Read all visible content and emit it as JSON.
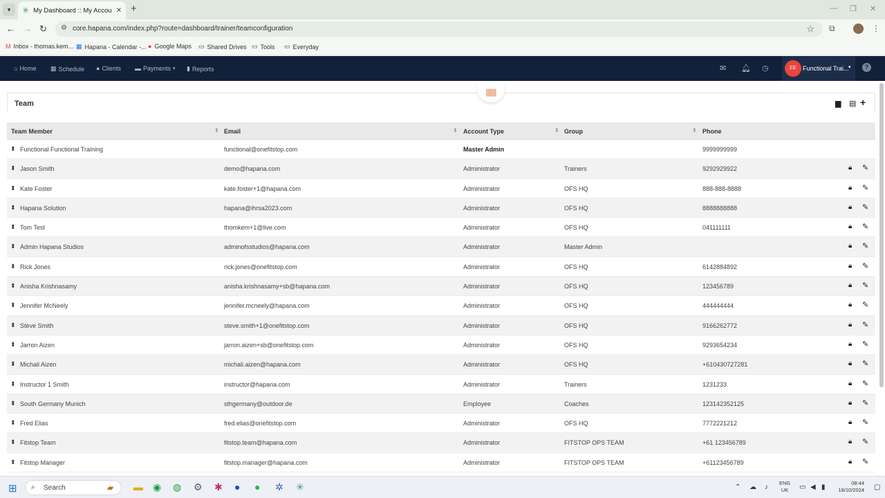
{
  "browser": {
    "tab_title": "My Dashboard :: My Account",
    "url": "core.hapana.com/index.php?route=dashboard/trainer/teamconfiguration",
    "bookmarks": [
      {
        "label": "Inbox - thomas.kem...",
        "icon": "gmail-icon"
      },
      {
        "label": "Hapana - Calendar -...",
        "icon": "calendar-icon"
      },
      {
        "label": "Google Maps",
        "icon": "maps-icon"
      },
      {
        "label": "Shared Drives",
        "icon": "folder-icon"
      },
      {
        "label": "Tools",
        "icon": "folder-icon"
      },
      {
        "label": "Everyday",
        "icon": "folder-icon"
      }
    ]
  },
  "nav": {
    "items": [
      "Home",
      "Schedule",
      "Clients",
      "Payments",
      "Reports"
    ],
    "user_initials": "FF",
    "user_name": "Functional Trai..."
  },
  "panel": {
    "title": "Team"
  },
  "table": {
    "columns": [
      "Team Member",
      "Email",
      "Account Type",
      "Group",
      "Phone"
    ],
    "rows": [
      {
        "member": "Functional Functional Training",
        "email": "functional@onefitstop.com",
        "type": "Master Admin",
        "group": "",
        "phone": "9999999999",
        "master": true
      },
      {
        "member": "Jason Smith",
        "email": "demo@hapana.com",
        "type": "Administrator",
        "group": "Trainers",
        "phone": "9292929922"
      },
      {
        "member": "Kate Foster",
        "email": "kate.foster+1@hapana.com",
        "type": "Administrator",
        "group": "OFS HQ",
        "phone": "888-888-8888"
      },
      {
        "member": "Hapana Solution",
        "email": "hapana@ihrsa2023.com",
        "type": "Administrator",
        "group": "OFS HQ",
        "phone": "8888888888"
      },
      {
        "member": "Tom Test",
        "email": "thomkem+1@live.com",
        "type": "Administrator",
        "group": "OFS HQ",
        "phone": "041111111"
      },
      {
        "member": "Admin Hapana Studios",
        "email": "adminofsstudios@hapana.com",
        "type": "Administrator",
        "group": "Master Admin",
        "phone": ""
      },
      {
        "member": "Rick Jones",
        "email": "rick.jones@onefitstop.com",
        "type": "Administrator",
        "group": "OFS HQ",
        "phone": "6142884892"
      },
      {
        "member": "Anisha Krishnasamy",
        "email": "anisha.krishnasamy+sb@hapana.com",
        "type": "Administrator",
        "group": "OFS HQ",
        "phone": "123456789"
      },
      {
        "member": "Jennifer McNeely",
        "email": "jennifer.mcneely@hapana.com",
        "type": "Administrator",
        "group": "OFS HQ",
        "phone": "444444444"
      },
      {
        "member": "Steve Smith",
        "email": "steve.smith+1@onefitstop.com",
        "type": "Administrator",
        "group": "OFS HQ",
        "phone": "9166262772"
      },
      {
        "member": "Jarron Aizen",
        "email": "jarron.aizen+sb@onefitstop.com",
        "type": "Administrator",
        "group": "OFS HQ",
        "phone": "9293654234"
      },
      {
        "member": "Michali Aizen",
        "email": "michali.aizen@hapana.com",
        "type": "Administrator",
        "group": "OFS HQ",
        "phone": "+610430727281"
      },
      {
        "member": "Instructor 1 Smith",
        "email": "instructor@hapana.com",
        "type": "Administrator",
        "group": "Trainers",
        "phone": "1231233"
      },
      {
        "member": "South Germany Munich",
        "email": "sthgermany@outdoor.de",
        "type": "Employee",
        "group": "Coaches",
        "phone": "123142352125"
      },
      {
        "member": "Fred Elias",
        "email": "fred.elias@onefitstop.com",
        "type": "Administrator",
        "group": "OFS HQ",
        "phone": "7772221212"
      },
      {
        "member": "Fitstop Team",
        "email": "fitstop.team@hapana.com",
        "type": "Administrator",
        "group": "FITSTOP OPS TEAM",
        "phone": "+61 123456789"
      },
      {
        "member": "Fitstop Manager",
        "email": "fitstop.manager@hapana.com",
        "type": "Administrator",
        "group": "FITSTOP OPS TEAM",
        "phone": "+61123456789"
      }
    ]
  },
  "taskbar": {
    "search_label": "Search",
    "lang_line1": "ENG",
    "lang_line2": "UK",
    "time": "08:44",
    "date": "18/10/2024"
  },
  "colors": {
    "nav_bg": "#12213a",
    "avatar": "#e8453c",
    "barcode_accent": "#e07030",
    "header_bg": "#e9e9e9",
    "alt_row": "#f2f2f2"
  }
}
